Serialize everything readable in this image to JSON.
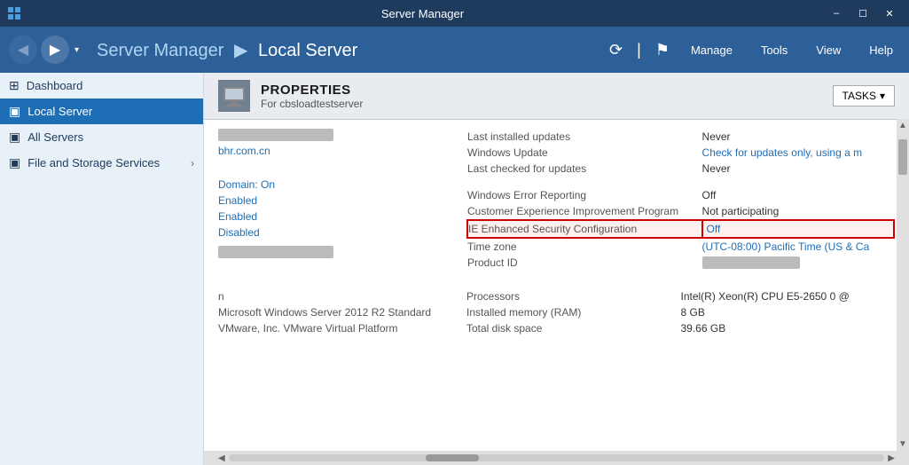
{
  "titlebar": {
    "title": "Server Manager",
    "min": "–",
    "max": "☐",
    "close": "✕"
  },
  "toolbar": {
    "back_label": "◀",
    "forward_label": "▶",
    "dropdown_label": "▾",
    "breadcrumb": "Server Manager",
    "separator": "▶",
    "location": "Local Server",
    "manage": "Manage",
    "tools": "Tools",
    "view": "View",
    "help": "Help"
  },
  "sidebar": {
    "dashboard_label": "Dashboard",
    "local_server_label": "Local Server",
    "all_servers_label": "All Servers",
    "file_storage_label": "File and Storage Services",
    "chevron": "›"
  },
  "properties": {
    "title": "PROPERTIES",
    "subtitle": "For cbsloadtestserver",
    "tasks_label": "TASKS",
    "tasks_arrow": "▾"
  },
  "left_props": {
    "hostname_bar": "",
    "domain_link": "Domain: On",
    "ie_security_administrators": "Enabled",
    "ie_security_users": "Enabled",
    "remote_management": "Disabled",
    "bottom_bar": "",
    "domain_value": "bhr.com.cn"
  },
  "right_props": {
    "last_installed_updates_label": "Last installed updates",
    "last_installed_updates_value": "Never",
    "windows_update_label": "Windows Update",
    "windows_update_value": "Check for updates only, using a m",
    "last_checked_label": "Last checked for updates",
    "last_checked_value": "Never",
    "windows_error_label": "Windows Error Reporting",
    "windows_error_value": "Off",
    "ceip_label": "Customer Experience Improvement Program",
    "ceip_value": "Not participating",
    "ie_enhanced_label": "IE Enhanced Security Configuration",
    "ie_enhanced_value": "Off",
    "time_zone_label": "Time zone",
    "time_zone_value": "(UTC-08:00) Pacific Time (US & Ca",
    "product_id_label": "Product ID",
    "product_id_bar": ""
  },
  "bottom_section": {
    "os_label": "Microsoft Windows Server 2012 R2 Standard",
    "vm_label": "VMware, Inc. VMware Virtual Platform",
    "processors_label": "Processors",
    "processors_value": "Intel(R) Xeon(R) CPU E5-2650 0 @",
    "ram_label": "Installed memory (RAM)",
    "ram_value": "8 GB",
    "disk_label": "Total disk space",
    "disk_value": "39.66 GB",
    "prefix_n": "n"
  },
  "icons": {
    "grid_icon": "⊞",
    "server_icon": "▣",
    "file_icon": "📁"
  }
}
